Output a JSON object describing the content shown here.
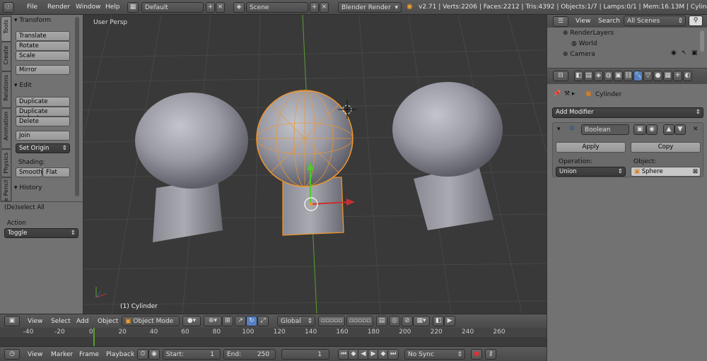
{
  "topbar": {
    "menus": [
      "File",
      "Render",
      "Window",
      "Help"
    ],
    "screen": "Default",
    "scene": "Scene",
    "engine": "Blender Render",
    "stats": "v2.71 | Verts:2206 | Faces:2212 | Tris:4392 | Objects:1/7 | Lamps:0/1 | Mem:16.13M | Cylinder"
  },
  "tools": {
    "tabs": [
      "Tools",
      "Create",
      "Relations",
      "Animation",
      "Physics",
      "Grease Pencil"
    ],
    "transform_header": "Transform",
    "translate": "Translate",
    "rotate": "Rotate",
    "scale": "Scale",
    "mirror": "Mirror",
    "edit_header": "Edit",
    "duplicate": "Duplicate",
    "duplicate_linked": "Duplicate Linked",
    "delete": "Delete",
    "join": "Join",
    "set_origin": "Set Origin",
    "shading_label": "Shading:",
    "smooth": "Smooth",
    "flat": "Flat",
    "history_header": "History"
  },
  "operator": {
    "header": "(De)select All",
    "action_label": "Action",
    "action_value": "Toggle"
  },
  "viewport": {
    "view_name": "User Persp",
    "object_label": "(1) Cylinder"
  },
  "header3d": {
    "menus": [
      "View",
      "Select",
      "Add",
      "Object"
    ],
    "mode": "Object Mode",
    "orientation": "Global"
  },
  "timeline": {
    "ticks": [
      "-40",
      "-20",
      "0",
      "20",
      "40",
      "60",
      "80",
      "100",
      "120",
      "140",
      "160",
      "180",
      "200",
      "220",
      "240",
      "260"
    ]
  },
  "timeline_header": {
    "menus": [
      "View",
      "Marker",
      "Frame",
      "Playback"
    ],
    "start_label": "Start:",
    "start_value": "1",
    "end_label": "End:",
    "end_value": "250",
    "current_frame": "1",
    "sync": "No Sync"
  },
  "outliner": {
    "view": "View",
    "search": "Search",
    "scenes": "All Scenes",
    "items": [
      "RenderLayers",
      "World",
      "Camera"
    ]
  },
  "properties": {
    "object_name": "Cylinder",
    "add_modifier": "Add Modifier",
    "modifier_name": "Boolean",
    "apply": "Apply",
    "copy": "Copy",
    "operation_label": "Operation:",
    "operation_value": "Union",
    "object_label": "Object:",
    "object_value": "Sphere"
  },
  "colors": {
    "selection": "#f0962c",
    "grid": "#474747",
    "y_axis": "#5aa02c",
    "x_axis": "#c84040",
    "panel": "#727272"
  }
}
